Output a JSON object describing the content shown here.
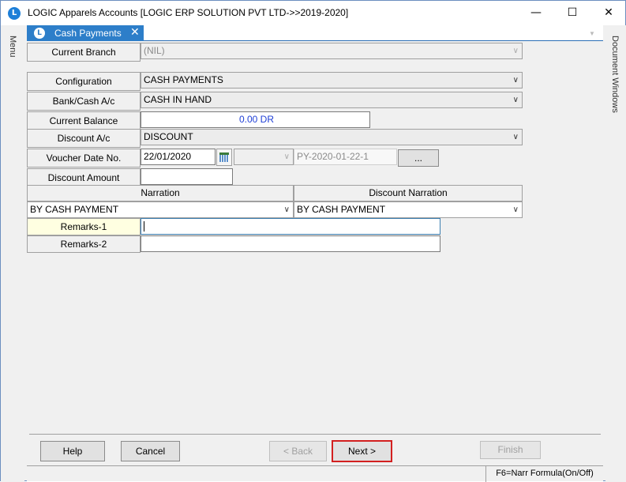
{
  "window": {
    "title": "LOGIC Apparels Accounts  [LOGIC ERP SOLUTION PVT LTD->>2019-2020]",
    "app_icon": "L",
    "minimize": "—",
    "maximize": "☐",
    "close": "✕"
  },
  "sidebar": {
    "left_label": "Menu",
    "right_label": "Document Windows"
  },
  "tab": {
    "label": "Cash Payments",
    "icon": "L",
    "close": "✕"
  },
  "form": {
    "current_branch": {
      "label": "Current Branch",
      "value": "(NIL)"
    },
    "configuration": {
      "label": "Configuration",
      "value": "CASH PAYMENTS"
    },
    "bank_cash": {
      "label": "Bank/Cash A/c",
      "value": "CASH IN HAND"
    },
    "current_balance": {
      "label": "Current Balance",
      "value": "0.00 DR"
    },
    "discount_ac": {
      "label": "Discount A/c",
      "value": "DISCOUNT"
    },
    "voucher": {
      "label": "Voucher Date  No.",
      "date": "22/01/2020",
      "series": "",
      "number": "PY-2020-01-22-1",
      "browse": "..."
    },
    "discount_amount": {
      "label": "Discount Amount",
      "value": ""
    },
    "narration": {
      "header": "Narration",
      "value": "BY CASH PAYMENT"
    },
    "discount_narration": {
      "header": "Discount Narration",
      "value": "BY CASH PAYMENT"
    },
    "remarks1": {
      "label": "Remarks-1",
      "value": ""
    },
    "remarks2": {
      "label": "Remarks-2",
      "value": ""
    }
  },
  "buttons": {
    "help": "Help",
    "cancel": "Cancel",
    "back": "< Back",
    "next": "Next >",
    "finish": "Finish"
  },
  "status": {
    "text": "F6=Narr Formula(On/Off)"
  },
  "colors": {
    "tab": "#2d7ec9",
    "balance_text": "#1f3fd6",
    "highlight": "#d32020",
    "remarks_label": "#ffffe1"
  }
}
